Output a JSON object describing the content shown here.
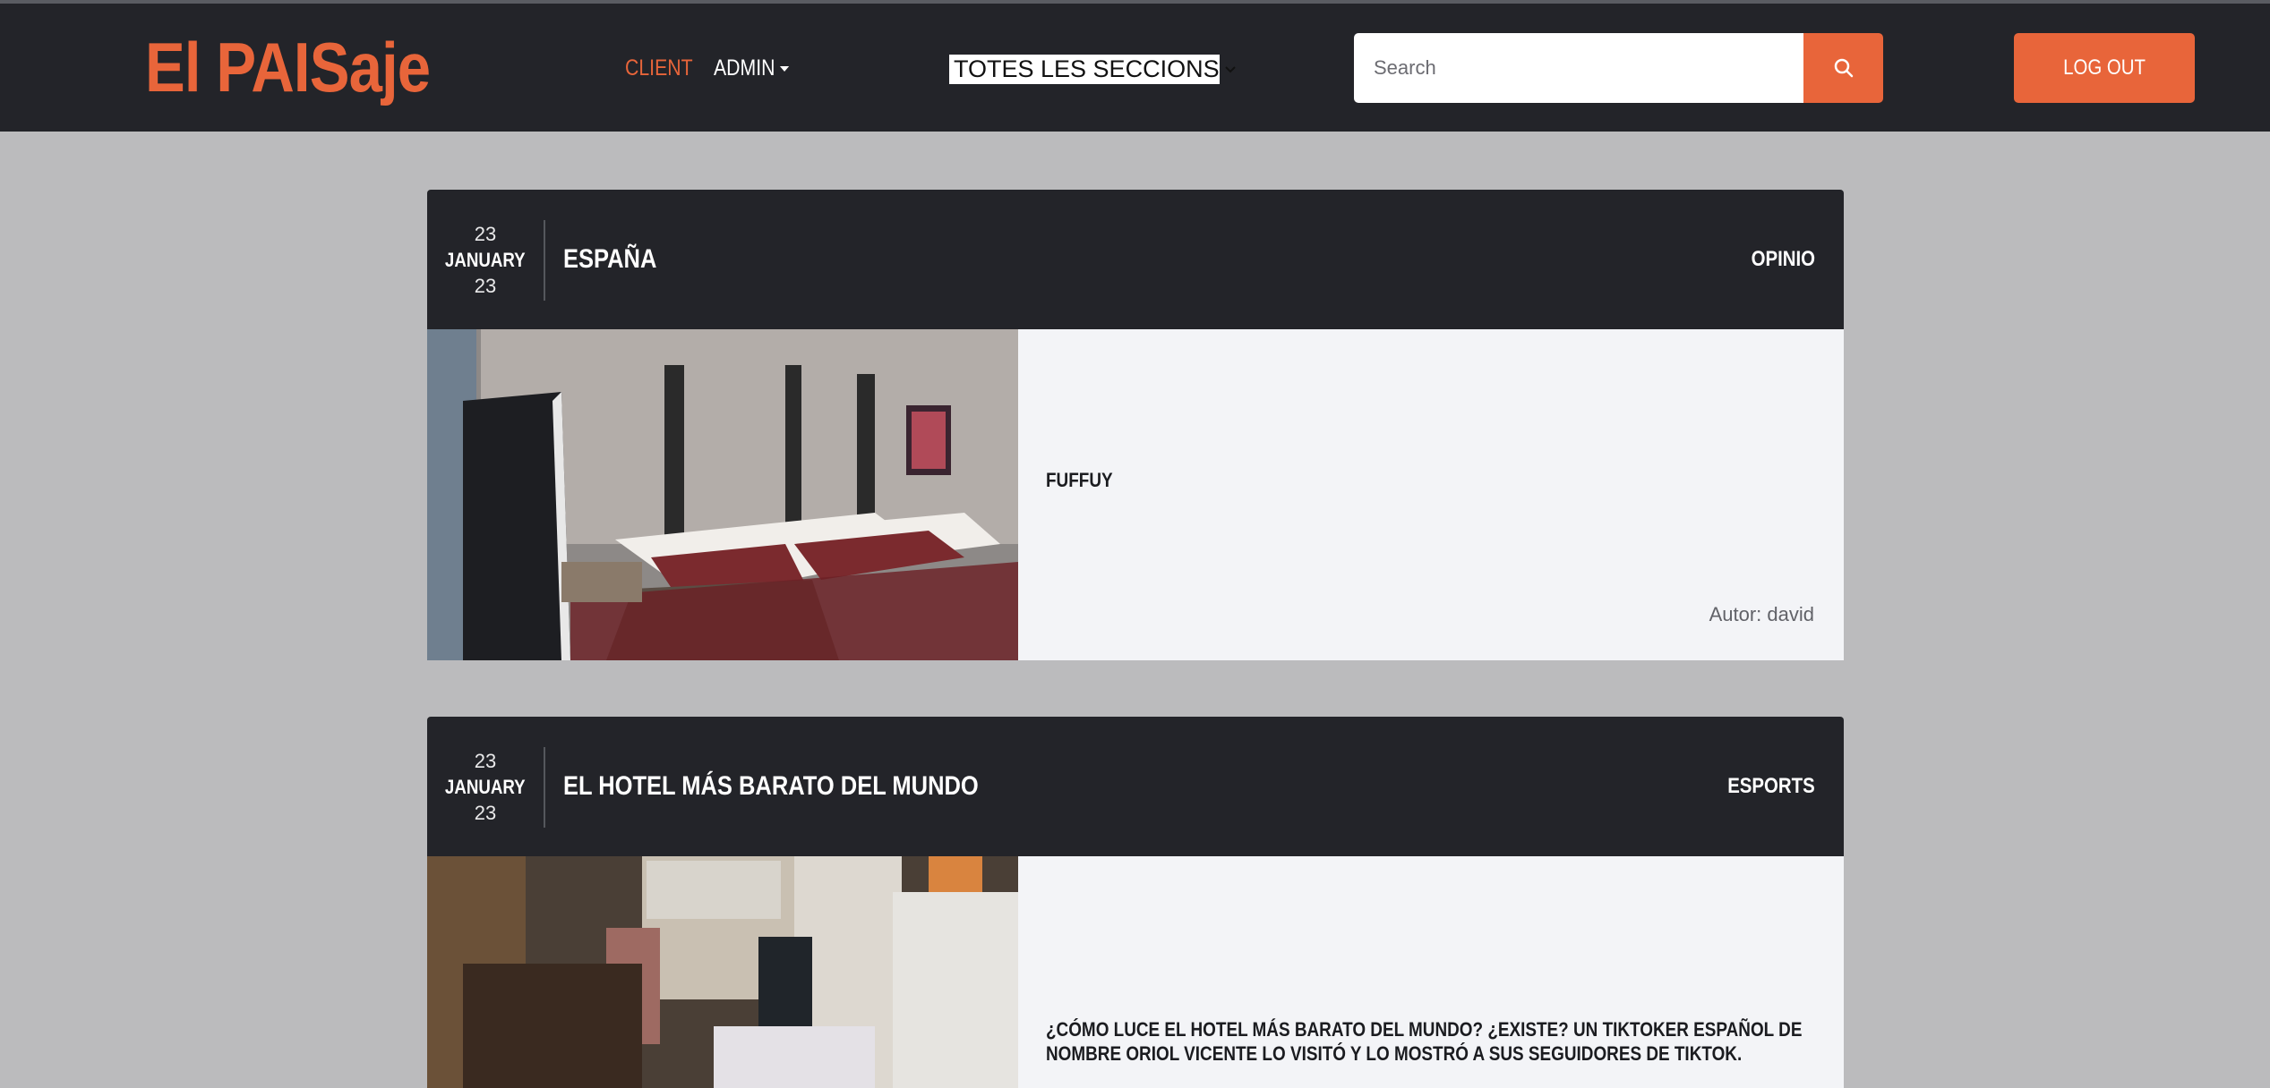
{
  "header": {
    "logo": "El PAISaje",
    "nav": {
      "client": "CLIENT",
      "admin": "ADMIN"
    },
    "section_select": "TOTES LES SECCIONS",
    "search": {
      "placeholder": "Search",
      "icon": "search-icon"
    },
    "logout": "LOG OUT"
  },
  "colors": {
    "accent": "#e8653a",
    "dark": "#232429",
    "page_bg": "#bbbbbd",
    "card_bg": "#f3f4f7"
  },
  "articles": [
    {
      "day": "23",
      "month": "JANUARY",
      "year": "23",
      "title": "ESPAÑA",
      "category": "OPINIO",
      "summary": "FUFFUY",
      "author": "Autor: david",
      "image": "hotel-bedroom-photo"
    },
    {
      "day": "23",
      "month": "JANUARY",
      "year": "23",
      "title": "EL HOTEL MÁS BARATO DEL MUNDO",
      "category": "ESPORTS",
      "summary": "¿CÓMO LUCE EL HOTEL MÁS BARATO DEL MUNDO? ¿EXISTE? UN TIKTOKER ESPAÑOL DE NOMBRE ORIOL VICENTE LO VISITÓ Y LO MOSTRÓ A SUS SEGUIDORES DE TIKTOK.",
      "image": "cheap-hotel-room-photo"
    }
  ]
}
